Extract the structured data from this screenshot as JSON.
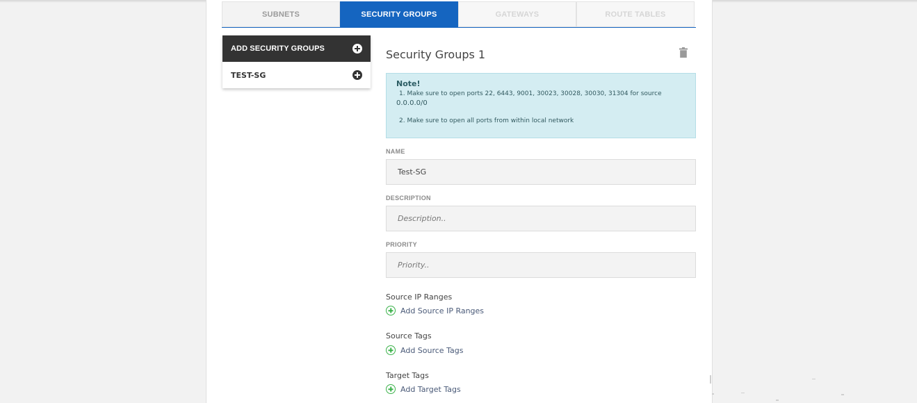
{
  "tabs": [
    {
      "label": "SUBNETS",
      "state": "normal"
    },
    {
      "label": "SECURITY GROUPS",
      "state": "active"
    },
    {
      "label": "GATEWAYS",
      "state": "disabled"
    },
    {
      "label": "ROUTE TABLES",
      "state": "disabled"
    }
  ],
  "sidebar": {
    "add_label": "ADD SECURITY GROUPS",
    "items": [
      {
        "label": "TEST-SG"
      }
    ]
  },
  "main": {
    "title": "Security Groups 1",
    "note": {
      "title": "Note!",
      "line1": "1. Make sure to open ports 22, 6443, 9001, 30023, 30028, 30030, 31304 for source",
      "line1_cont": "0.0.0.0/0",
      "line2": "2. Make sure to open all ports from within local network"
    },
    "name": {
      "label": "NAME",
      "value": "Test-SG"
    },
    "description": {
      "label": "DESCRIPTION",
      "placeholder": "Description.."
    },
    "priority": {
      "label": "PRIORITY",
      "placeholder": "Priority.."
    },
    "source_ip": {
      "label": "Source IP Ranges",
      "add_label": "Add Source IP Ranges"
    },
    "source_tags": {
      "label": "Source Tags",
      "add_label": "Add Source Tags"
    },
    "target_tags": {
      "label": "Target Tags",
      "add_label": "Add Target Tags"
    }
  },
  "colors": {
    "accent": "#1565c0",
    "dark": "#333333",
    "note_bg": "#d4edf2",
    "add_icon": "#3bb24a"
  },
  "icons": [
    "add-circle-icon",
    "trash-icon",
    "plus-circle-outline-icon"
  ]
}
